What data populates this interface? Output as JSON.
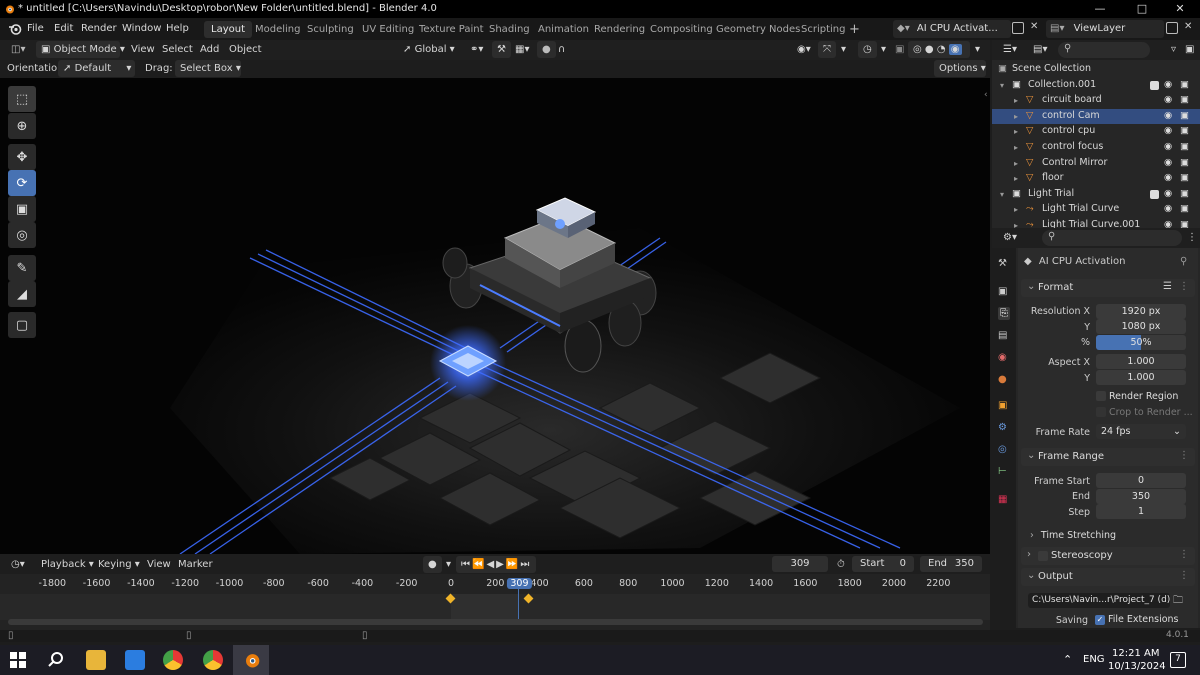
{
  "titlebar": {
    "title": "* untitled [C:\\Users\\Navindu\\Desktop\\robor\\New Folder\\untitled.blend] - Blender 4.0"
  },
  "menu": [
    "File",
    "Edit",
    "Render",
    "Window",
    "Help"
  ],
  "workspaces": [
    "Layout",
    "Modeling",
    "Sculpting",
    "UV Editing",
    "Texture Paint",
    "Shading",
    "Animation",
    "Rendering",
    "Compositing",
    "Geometry Nodes",
    "Scripting"
  ],
  "active_workspace": "Layout",
  "scene_name": "AI CPU Activat...",
  "view_layer": "ViewLayer",
  "viewport_header": {
    "mode": "Object Mode",
    "menus": [
      "View",
      "Select",
      "Add",
      "Object"
    ],
    "transform": "Global",
    "orientation_label": "Orientation:",
    "orientation_value": "Default",
    "drag_label": "Drag:",
    "drag_value": "Select Box",
    "options": "Options"
  },
  "outliner": {
    "root": "Scene Collection",
    "items": [
      {
        "label": "Collection.001",
        "indent": 1,
        "type": "collection"
      },
      {
        "label": "circuit board",
        "indent": 2,
        "type": "object"
      },
      {
        "label": "control Cam",
        "indent": 2,
        "type": "object",
        "selected": true
      },
      {
        "label": "control cpu",
        "indent": 2,
        "type": "object"
      },
      {
        "label": "control focus",
        "indent": 2,
        "type": "object"
      },
      {
        "label": "Control Mirror",
        "indent": 2,
        "type": "object"
      },
      {
        "label": "floor",
        "indent": 2,
        "type": "object"
      },
      {
        "label": "Light Trial",
        "indent": 1,
        "type": "collection"
      },
      {
        "label": "Light Trial Curve",
        "indent": 2,
        "type": "curve"
      },
      {
        "label": "Light Trial Curve.001",
        "indent": 2,
        "type": "curve"
      }
    ]
  },
  "properties": {
    "scene": "AI CPU Activation",
    "format": {
      "title": "Format",
      "res_x_label": "Resolution X",
      "res_x": "1920 px",
      "res_y_label": "Y",
      "res_y": "1080 px",
      "pct_label": "%",
      "pct": "50%",
      "pct_fraction": 0.5,
      "aspect_x_label": "Aspect X",
      "aspect_x": "1.000",
      "aspect_y_label": "Y",
      "aspect_y": "1.000",
      "render_region": "Render Region",
      "crop": "Crop to Render ...",
      "frame_rate_label": "Frame Rate",
      "frame_rate": "24 fps"
    },
    "frame_range": {
      "title": "Frame Range",
      "start_label": "Frame Start",
      "start": "0",
      "end_label": "End",
      "end": "350",
      "step_label": "Step",
      "step": "1"
    },
    "time_stretching": "Time Stretching",
    "stereoscopy": "Stereoscopy",
    "output": {
      "title": "Output",
      "path": "C:\\Users\\Navin...r\\Project_7 (d)_",
      "saving_label": "Saving",
      "file_ext": "File Extensions"
    }
  },
  "timeline": {
    "menus": [
      "Playback",
      "Keying",
      "View",
      "Marker"
    ],
    "current_frame": "309",
    "start_label": "Start",
    "start": "0",
    "end_label": "End",
    "end": "350",
    "ticks": [
      "-1800",
      "-1600",
      "-1400",
      "-1200",
      "-1000",
      "-800",
      "-600",
      "-400",
      "-200",
      "0",
      "200",
      "309",
      "400",
      "600",
      "800",
      "1000",
      "1200",
      "1400",
      "1600",
      "1800",
      "2000",
      "2200"
    ]
  },
  "version": "4.0.1",
  "taskbar": {
    "lang": "ENG",
    "time": "12:21 AM",
    "date": "10/13/2024",
    "notif": "7"
  },
  "colors": {
    "accent": "#4772b3",
    "selected_row": "#334d80",
    "glow": "#3d6bff"
  }
}
